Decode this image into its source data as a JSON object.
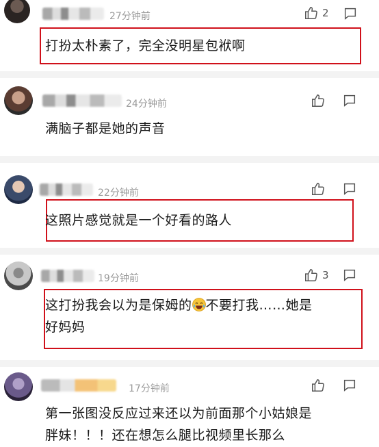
{
  "comments": [
    {
      "time": "27分钟前",
      "text": "打扮太朴素了，完全没明星包袱啊",
      "likes": "2",
      "highlighted": true
    },
    {
      "time": "24分钟前",
      "text": "满脑子都是她的声音",
      "likes": "",
      "highlighted": false
    },
    {
      "time": "22分钟前",
      "text": "这照片感觉就是一个好看的路人",
      "likes": "",
      "highlighted": true
    },
    {
      "time": "19分钟前",
      "text_before_emoji": "这打扮我会以为是保姆的",
      "text_after_emoji": "不要打我……她是",
      "text_line2": "好妈妈",
      "likes": "3",
      "highlighted": true
    },
    {
      "time": "17分钟前",
      "text_line1": "第一张图没反应过来还以为前面那个小姑娘是",
      "text_line2": "胖妹！！！还在想怎么腿比视频里长那么",
      "likes": "",
      "highlighted": false
    }
  ],
  "icons": {
    "like": "thumbs-up-icon",
    "reply": "comment-bubble-icon",
    "emoji": "tears-of-joy-emoji"
  },
  "colors": {
    "highlight_border": "#d0101a",
    "time_text": "#9a9a9a",
    "separator": "#f3f3f3"
  }
}
